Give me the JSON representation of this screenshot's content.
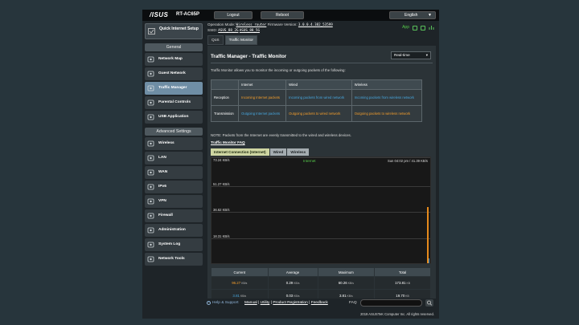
{
  "header": {
    "logo_text": "/ISUS",
    "model": "RT-AC65P",
    "logout_label": "Logout",
    "reboot_label": "Reboot",
    "language_label": "English"
  },
  "status": {
    "operation_mode_label": "Operation Mode:",
    "operation_mode_value": "Wireless router",
    "firmware_label": "Firmware Version:",
    "firmware_value": "3.0.0.4.382_53599",
    "ssid_label": "SSID:",
    "ssid_2g": "ASUS_88_2G",
    "ssid_5g": "ASUS_88_5G",
    "app_label": "App"
  },
  "sidebar": {
    "qis_label": "Quick Internet Setup",
    "general_label": "General",
    "general_items": [
      {
        "label": "Network Map",
        "icon": "network-map-icon"
      },
      {
        "label": "Guest Network",
        "icon": "guest-network-icon"
      },
      {
        "label": "Traffic Manager",
        "icon": "traffic-manager-icon"
      },
      {
        "label": "Parental Controls",
        "icon": "parental-controls-icon"
      },
      {
        "label": "USB Application",
        "icon": "usb-application-icon"
      }
    ],
    "advanced_label": "Advanced Settings",
    "advanced_items": [
      {
        "label": "Wireless",
        "icon": "wireless-icon"
      },
      {
        "label": "LAN",
        "icon": "lan-icon"
      },
      {
        "label": "WAN",
        "icon": "wan-icon"
      },
      {
        "label": "IPv6",
        "icon": "ipv6-icon"
      },
      {
        "label": "VPN",
        "icon": "vpn-icon"
      },
      {
        "label": "Firewall",
        "icon": "firewall-icon"
      },
      {
        "label": "Administration",
        "icon": "administration-icon"
      },
      {
        "label": "System Log",
        "icon": "system-log-icon"
      },
      {
        "label": "Network Tools",
        "icon": "network-tools-icon"
      }
    ]
  },
  "tabs": [
    "QoS",
    "Traffic Monitor"
  ],
  "panel": {
    "title": "Traffic Manager - Traffic Monitor",
    "mode_select": "Real-time",
    "description": "Traffic Monitor allows you to monitor the incoming or outgoing packets of the following:",
    "table": {
      "headers": [
        "",
        "Internet",
        "Wired",
        "Wireless"
      ],
      "rows": [
        [
          "Reception",
          "Incoming Internet packets",
          "Incoming packets from wired network",
          "Incoming packets from wireless network"
        ],
        [
          "Transmission",
          "Outgoing Internet packets",
          "Outgoing packets to wired network",
          "Outgoing packets to wireless network"
        ]
      ]
    },
    "note": "NOTE: Packets from the Internet are evenly transmitted to the wired and wireless devices.",
    "faq_link": "Traffic Monitor FAQ",
    "subtabs": [
      "Internet Connection (Internet)",
      "Wired",
      "Wireless"
    ],
    "graph": {
      "title": "Internet",
      "time_readout": "Sun 04:02 pm / 41.39 KB/s",
      "y_labels": [
        "73.24 KB/s",
        "51.27 KB/s",
        "36.62 KB/s",
        "18.31 KB/s"
      ]
    },
    "stats": {
      "headers": [
        "Current",
        "Average",
        "Maximum",
        "Total"
      ],
      "rows": [
        {
          "current": "96.27",
          "current_unit": "KB/s",
          "average": "0.29",
          "average_unit": "KB/s",
          "maximum": "60.26",
          "maximum_unit": "KB/s",
          "total": "173.81",
          "total_unit": "KB"
        },
        {
          "current": "3.81",
          "current_unit": "KB/s",
          "average": "0.03",
          "average_unit": "KB/s",
          "maximum": "3.81",
          "maximum_unit": "KB/s",
          "total": "19.70",
          "total_unit": "KB"
        }
      ]
    }
  },
  "footer": {
    "help_label": "Help & Support",
    "links": [
      "Manual",
      "Utility",
      "Product Registration",
      "Feedback"
    ],
    "faq_label": "FAQ",
    "copyright": "2019 ASUSTeK Computer Inc. All rights reserved."
  },
  "colors": {
    "reception": "#f29d2c",
    "transmission": "#47a6dd",
    "active_nav": "#6f8ea5",
    "status_green": "#55c84a"
  }
}
